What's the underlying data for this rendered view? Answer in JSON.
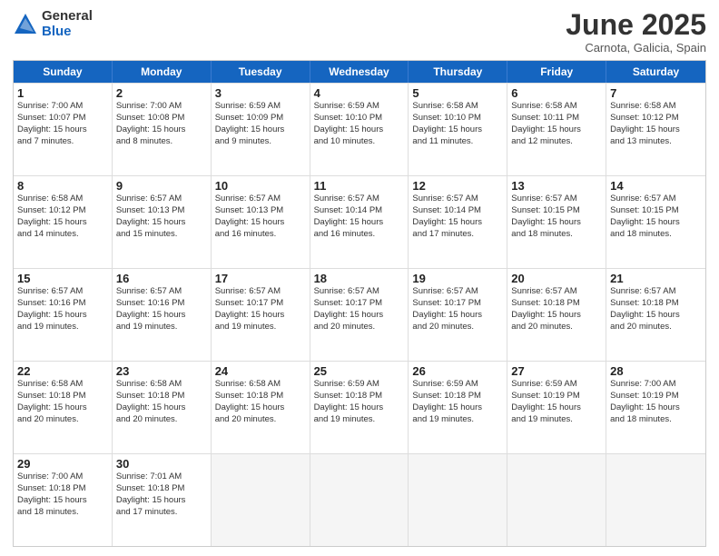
{
  "logo": {
    "general": "General",
    "blue": "Blue"
  },
  "title": "June 2025",
  "location": "Carnota, Galicia, Spain",
  "header_days": [
    "Sunday",
    "Monday",
    "Tuesday",
    "Wednesday",
    "Thursday",
    "Friday",
    "Saturday"
  ],
  "weeks": [
    [
      {
        "day": "1",
        "info": "Sunrise: 7:00 AM\nSunset: 10:07 PM\nDaylight: 15 hours\nand 7 minutes."
      },
      {
        "day": "2",
        "info": "Sunrise: 7:00 AM\nSunset: 10:08 PM\nDaylight: 15 hours\nand 8 minutes."
      },
      {
        "day": "3",
        "info": "Sunrise: 6:59 AM\nSunset: 10:09 PM\nDaylight: 15 hours\nand 9 minutes."
      },
      {
        "day": "4",
        "info": "Sunrise: 6:59 AM\nSunset: 10:10 PM\nDaylight: 15 hours\nand 10 minutes."
      },
      {
        "day": "5",
        "info": "Sunrise: 6:58 AM\nSunset: 10:10 PM\nDaylight: 15 hours\nand 11 minutes."
      },
      {
        "day": "6",
        "info": "Sunrise: 6:58 AM\nSunset: 10:11 PM\nDaylight: 15 hours\nand 12 minutes."
      },
      {
        "day": "7",
        "info": "Sunrise: 6:58 AM\nSunset: 10:12 PM\nDaylight: 15 hours\nand 13 minutes."
      }
    ],
    [
      {
        "day": "8",
        "info": "Sunrise: 6:58 AM\nSunset: 10:12 PM\nDaylight: 15 hours\nand 14 minutes."
      },
      {
        "day": "9",
        "info": "Sunrise: 6:57 AM\nSunset: 10:13 PM\nDaylight: 15 hours\nand 15 minutes."
      },
      {
        "day": "10",
        "info": "Sunrise: 6:57 AM\nSunset: 10:13 PM\nDaylight: 15 hours\nand 16 minutes."
      },
      {
        "day": "11",
        "info": "Sunrise: 6:57 AM\nSunset: 10:14 PM\nDaylight: 15 hours\nand 16 minutes."
      },
      {
        "day": "12",
        "info": "Sunrise: 6:57 AM\nSunset: 10:14 PM\nDaylight: 15 hours\nand 17 minutes."
      },
      {
        "day": "13",
        "info": "Sunrise: 6:57 AM\nSunset: 10:15 PM\nDaylight: 15 hours\nand 18 minutes."
      },
      {
        "day": "14",
        "info": "Sunrise: 6:57 AM\nSunset: 10:15 PM\nDaylight: 15 hours\nand 18 minutes."
      }
    ],
    [
      {
        "day": "15",
        "info": "Sunrise: 6:57 AM\nSunset: 10:16 PM\nDaylight: 15 hours\nand 19 minutes."
      },
      {
        "day": "16",
        "info": "Sunrise: 6:57 AM\nSunset: 10:16 PM\nDaylight: 15 hours\nand 19 minutes."
      },
      {
        "day": "17",
        "info": "Sunrise: 6:57 AM\nSunset: 10:17 PM\nDaylight: 15 hours\nand 19 minutes."
      },
      {
        "day": "18",
        "info": "Sunrise: 6:57 AM\nSunset: 10:17 PM\nDaylight: 15 hours\nand 20 minutes."
      },
      {
        "day": "19",
        "info": "Sunrise: 6:57 AM\nSunset: 10:17 PM\nDaylight: 15 hours\nand 20 minutes."
      },
      {
        "day": "20",
        "info": "Sunrise: 6:57 AM\nSunset: 10:18 PM\nDaylight: 15 hours\nand 20 minutes."
      },
      {
        "day": "21",
        "info": "Sunrise: 6:57 AM\nSunset: 10:18 PM\nDaylight: 15 hours\nand 20 minutes."
      }
    ],
    [
      {
        "day": "22",
        "info": "Sunrise: 6:58 AM\nSunset: 10:18 PM\nDaylight: 15 hours\nand 20 minutes."
      },
      {
        "day": "23",
        "info": "Sunrise: 6:58 AM\nSunset: 10:18 PM\nDaylight: 15 hours\nand 20 minutes."
      },
      {
        "day": "24",
        "info": "Sunrise: 6:58 AM\nSunset: 10:18 PM\nDaylight: 15 hours\nand 20 minutes."
      },
      {
        "day": "25",
        "info": "Sunrise: 6:59 AM\nSunset: 10:18 PM\nDaylight: 15 hours\nand 19 minutes."
      },
      {
        "day": "26",
        "info": "Sunrise: 6:59 AM\nSunset: 10:18 PM\nDaylight: 15 hours\nand 19 minutes."
      },
      {
        "day": "27",
        "info": "Sunrise: 6:59 AM\nSunset: 10:19 PM\nDaylight: 15 hours\nand 19 minutes."
      },
      {
        "day": "28",
        "info": "Sunrise: 7:00 AM\nSunset: 10:19 PM\nDaylight: 15 hours\nand 18 minutes."
      }
    ],
    [
      {
        "day": "29",
        "info": "Sunrise: 7:00 AM\nSunset: 10:18 PM\nDaylight: 15 hours\nand 18 minutes."
      },
      {
        "day": "30",
        "info": "Sunrise: 7:01 AM\nSunset: 10:18 PM\nDaylight: 15 hours\nand 17 minutes."
      },
      {
        "day": "",
        "info": ""
      },
      {
        "day": "",
        "info": ""
      },
      {
        "day": "",
        "info": ""
      },
      {
        "day": "",
        "info": ""
      },
      {
        "day": "",
        "info": ""
      }
    ]
  ]
}
